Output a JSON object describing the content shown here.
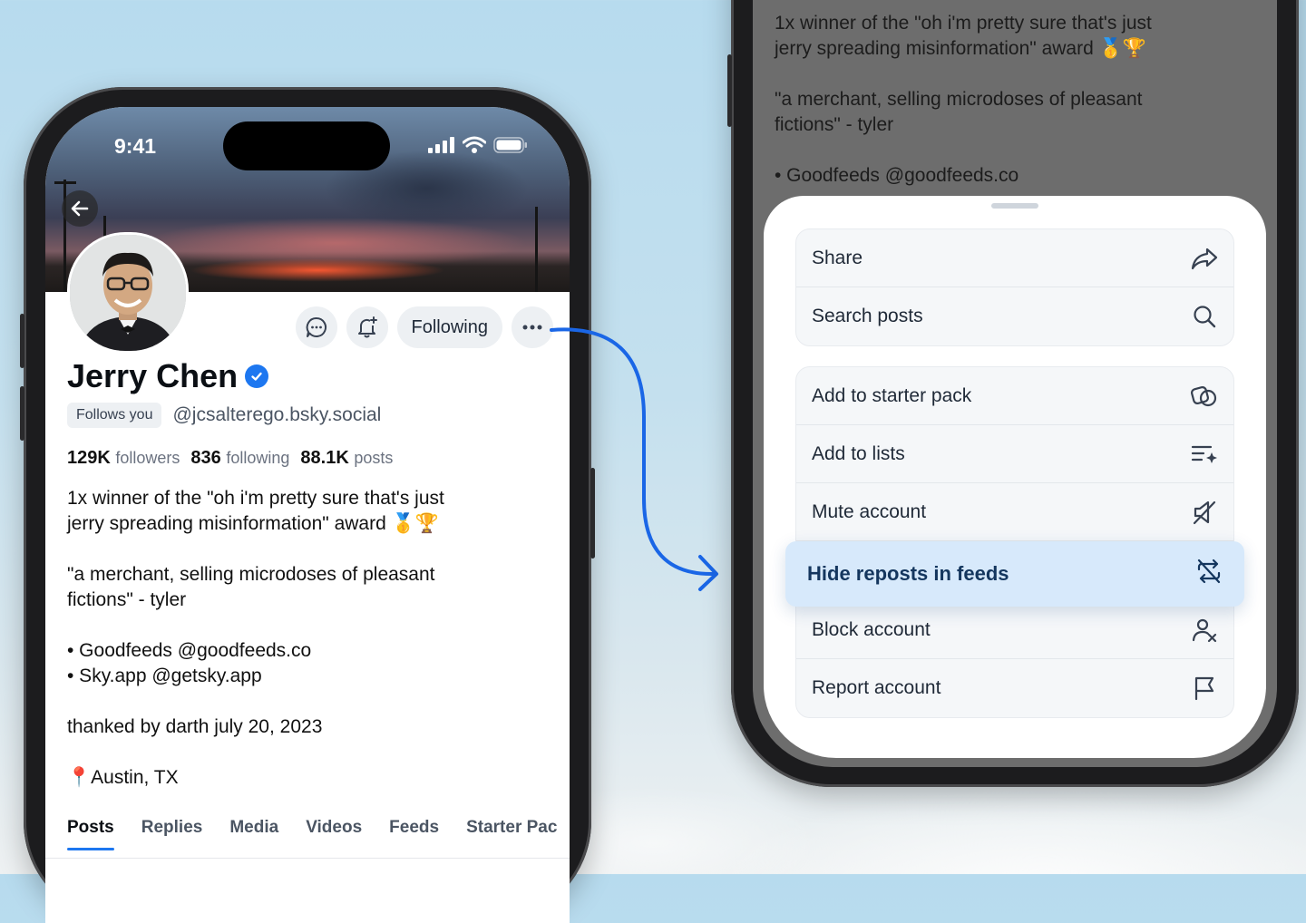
{
  "left_phone": {
    "status_time": "9:41",
    "profile": {
      "name": "Jerry Chen",
      "follows_badge": "Follows you",
      "handle": "@jcsalterego.bsky.social",
      "stats": [
        {
          "value": "129K",
          "label": "followers"
        },
        {
          "value": "836",
          "label": "following"
        },
        {
          "value": "88.1K",
          "label": "posts"
        }
      ],
      "bio": [
        "1x winner of the \"oh i'm pretty sure that's just\njerry spreading misinformation\" award 🥇🏆",
        "\"a merchant, selling microdoses of pleasant\nfictions\" - tyler",
        "• Goodfeeds @goodfeeds.co\n• Sky.app @getsky.app",
        "thanked by darth july 20, 2023",
        "📍Austin, TX"
      ]
    },
    "actions": {
      "following_label": "Following"
    },
    "tabs": [
      "Posts",
      "Replies",
      "Media",
      "Videos",
      "Feeds",
      "Starter Pac"
    ],
    "active_tab": "Posts"
  },
  "right_phone": {
    "dimmed_bio": [
      "1x winner of the \"oh i'm pretty sure that's just\njerry spreading misinformation\" award 🥇🏆",
      "\"a merchant, selling microdoses of pleasant\nfictions\" - tyler",
      "• Goodfeeds @goodfeeds.co"
    ],
    "menu": {
      "group1": [
        {
          "label": "Share",
          "icon": "share-icon"
        },
        {
          "label": "Search posts",
          "icon": "search-icon"
        }
      ],
      "group2": [
        {
          "label": "Add to starter pack",
          "icon": "starter-pack-icon"
        },
        {
          "label": "Add to lists",
          "icon": "list-add-icon"
        },
        {
          "label": "Mute account",
          "icon": "mute-icon"
        },
        {
          "label": "Hide reposts in feeds",
          "icon": "hide-reposts-icon",
          "highlighted": true
        },
        {
          "label": "Block account",
          "icon": "block-user-icon"
        },
        {
          "label": "Report account",
          "icon": "flag-icon"
        }
      ]
    }
  },
  "colors": {
    "accent": "#1d77f0",
    "highlight_bg": "#d7e9fb"
  }
}
